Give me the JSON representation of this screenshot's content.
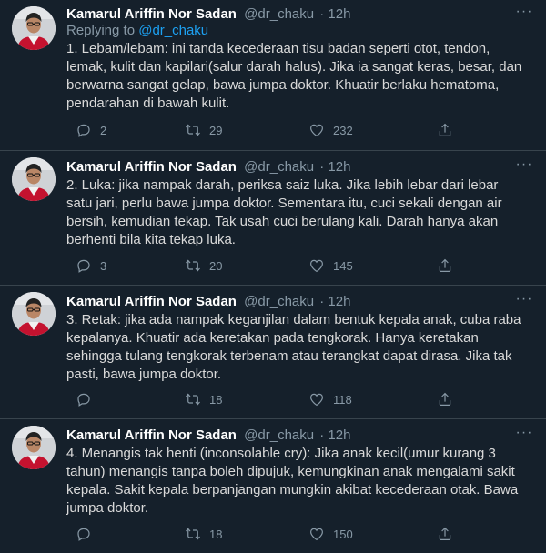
{
  "tweets": [
    {
      "name": "Kamarul Ariffin Nor Sadan",
      "handle": "@dr_chaku",
      "time": "· 12h",
      "replying_prefix": "Replying to",
      "replying_to": "@dr_chaku",
      "text": "1. Lebam/lebam: ini tanda kecederaan tisu badan seperti otot, tendon, lemak, kulit dan kapilari(salur darah halus). Jika ia sangat keras, besar, dan berwarna sangat gelap, bawa jumpa doktor. Khuatir berlaku hematoma, pendarahan di bawah kulit.",
      "replies": "2",
      "retweets": "29",
      "likes": "232"
    },
    {
      "name": "Kamarul Ariffin Nor Sadan",
      "handle": "@dr_chaku",
      "time": "· 12h",
      "text": "2. Luka: jika nampak darah, periksa saiz luka. Jika lebih lebar dari lebar satu jari, perlu bawa jumpa doktor. Sementara itu, cuci sekali dengan air bersih, kemudian tekap. Tak usah cuci berulang kali. Darah hanya akan berhenti bila kita tekap luka.",
      "replies": "3",
      "retweets": "20",
      "likes": "145"
    },
    {
      "name": "Kamarul Ariffin Nor Sadan",
      "handle": "@dr_chaku",
      "time": "· 12h",
      "text": "3. Retak: jika ada nampak keganjilan dalam bentuk kepala anak, cuba raba kepalanya. Khuatir ada keretakan pada tengkorak. Hanya keretakan sehingga tulang tengkorak terbenam atau terangkat dapat dirasa. Jika tak pasti, bawa jumpa doktor.",
      "replies": "",
      "retweets": "18",
      "likes": "118"
    },
    {
      "name": "Kamarul Ariffin Nor Sadan",
      "handle": "@dr_chaku",
      "time": "· 12h",
      "text": "4. Menangis tak henti (inconsolable cry): Jika anak kecil(umur kurang 3 tahun) menangis tanpa boleh dipujuk, kemungkinan anak mengalami sakit kepala. Sakit kepala berpanjangan mungkin akibat kecederaan otak. Bawa jumpa doktor.",
      "replies": "",
      "retweets": "18",
      "likes": "150"
    }
  ],
  "colors": {
    "background": "#15202b",
    "link": "#1da1f2",
    "muted": "#8899a6",
    "text": "#d9d9d9"
  },
  "icons": [
    "avatar",
    "more-icon",
    "reply-icon",
    "retweet-icon",
    "like-icon",
    "share-icon"
  ]
}
